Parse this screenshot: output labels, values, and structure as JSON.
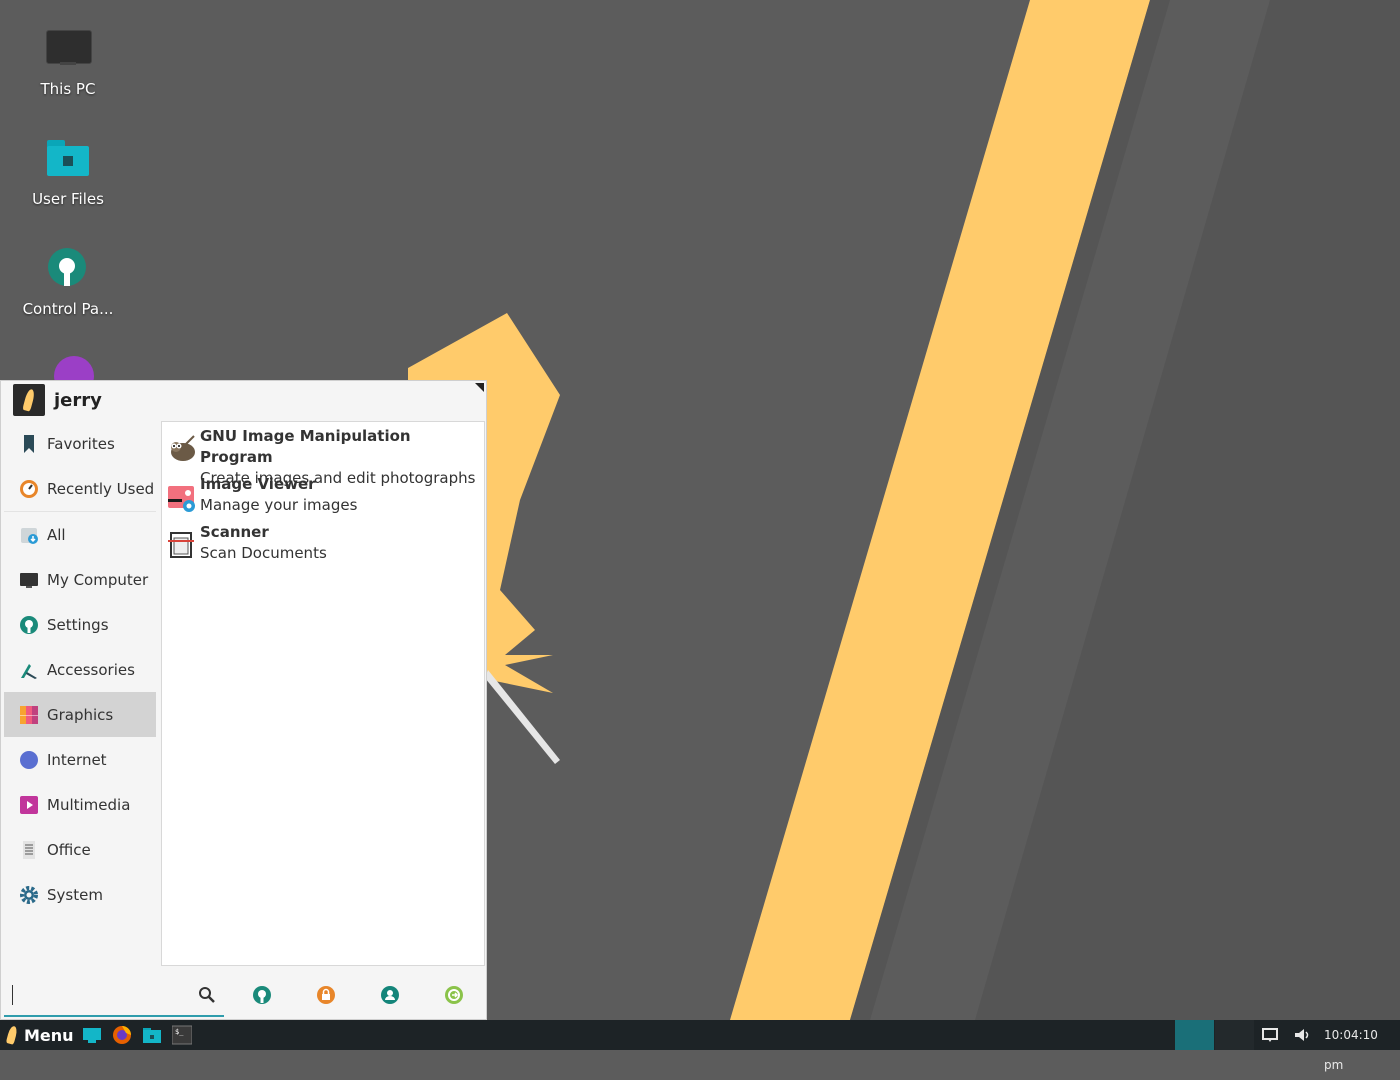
{
  "desktop": {
    "icons": [
      {
        "label": "This PC",
        "icon": "monitor-icon"
      },
      {
        "label": "User Files",
        "icon": "home-folder-icon"
      },
      {
        "label": "Control Pa...",
        "icon": "control-panel-icon"
      },
      {
        "label": "",
        "icon": "app-icon"
      }
    ]
  },
  "menu": {
    "user": {
      "name": "jerry",
      "avatar_icon": "user-avatar-icon"
    },
    "categories": [
      {
        "label": "Favorites",
        "icon": "bookmark-icon"
      },
      {
        "label": "Recently Used",
        "icon": "clock-icon"
      },
      {
        "label": "All",
        "icon": "all-apps-icon"
      },
      {
        "label": "My Computer",
        "icon": "monitor-icon"
      },
      {
        "label": "Settings",
        "icon": "settings-icon"
      },
      {
        "label": "Accessories",
        "icon": "accessories-icon"
      },
      {
        "label": "Graphics",
        "icon": "graphics-icon",
        "selected": true
      },
      {
        "label": "Internet",
        "icon": "compass-icon"
      },
      {
        "label": "Multimedia",
        "icon": "play-icon"
      },
      {
        "label": "Office",
        "icon": "document-icon"
      },
      {
        "label": "System",
        "icon": "gear-icon"
      }
    ],
    "apps": [
      {
        "name": "GNU Image Manipulation Program",
        "description": "Create images and edit photographs",
        "icon": "gimp-icon"
      },
      {
        "name": "Image Viewer",
        "description": "Manage your images",
        "icon": "image-viewer-icon"
      },
      {
        "name": "Scanner",
        "description": "Scan Documents",
        "icon": "scanner-icon"
      }
    ],
    "search": {
      "value": "",
      "placeholder": ""
    },
    "bottom_buttons": [
      {
        "name": "search-icon"
      },
      {
        "name": "settings-manager-icon",
        "color": "#1a8a7a"
      },
      {
        "name": "lock-screen-icon",
        "color": "#e8862a"
      },
      {
        "name": "switch-user-icon",
        "color": "#14857a"
      },
      {
        "name": "log-out-icon",
        "color": "#8bc34a"
      }
    ]
  },
  "taskbar": {
    "menu_label": "Menu",
    "launchers": [
      "desktop-icon",
      "firefox-icon",
      "file-manager-icon",
      "terminal-icon"
    ],
    "tray": [
      "notification-icon",
      "volume-icon"
    ],
    "clock": "10:04:10 pm"
  },
  "colors": {
    "accent": "#2f9cac",
    "wallpaper": "#5c5c5c",
    "stripe": "#ffcb6b",
    "taskbar": "#1d2326"
  }
}
